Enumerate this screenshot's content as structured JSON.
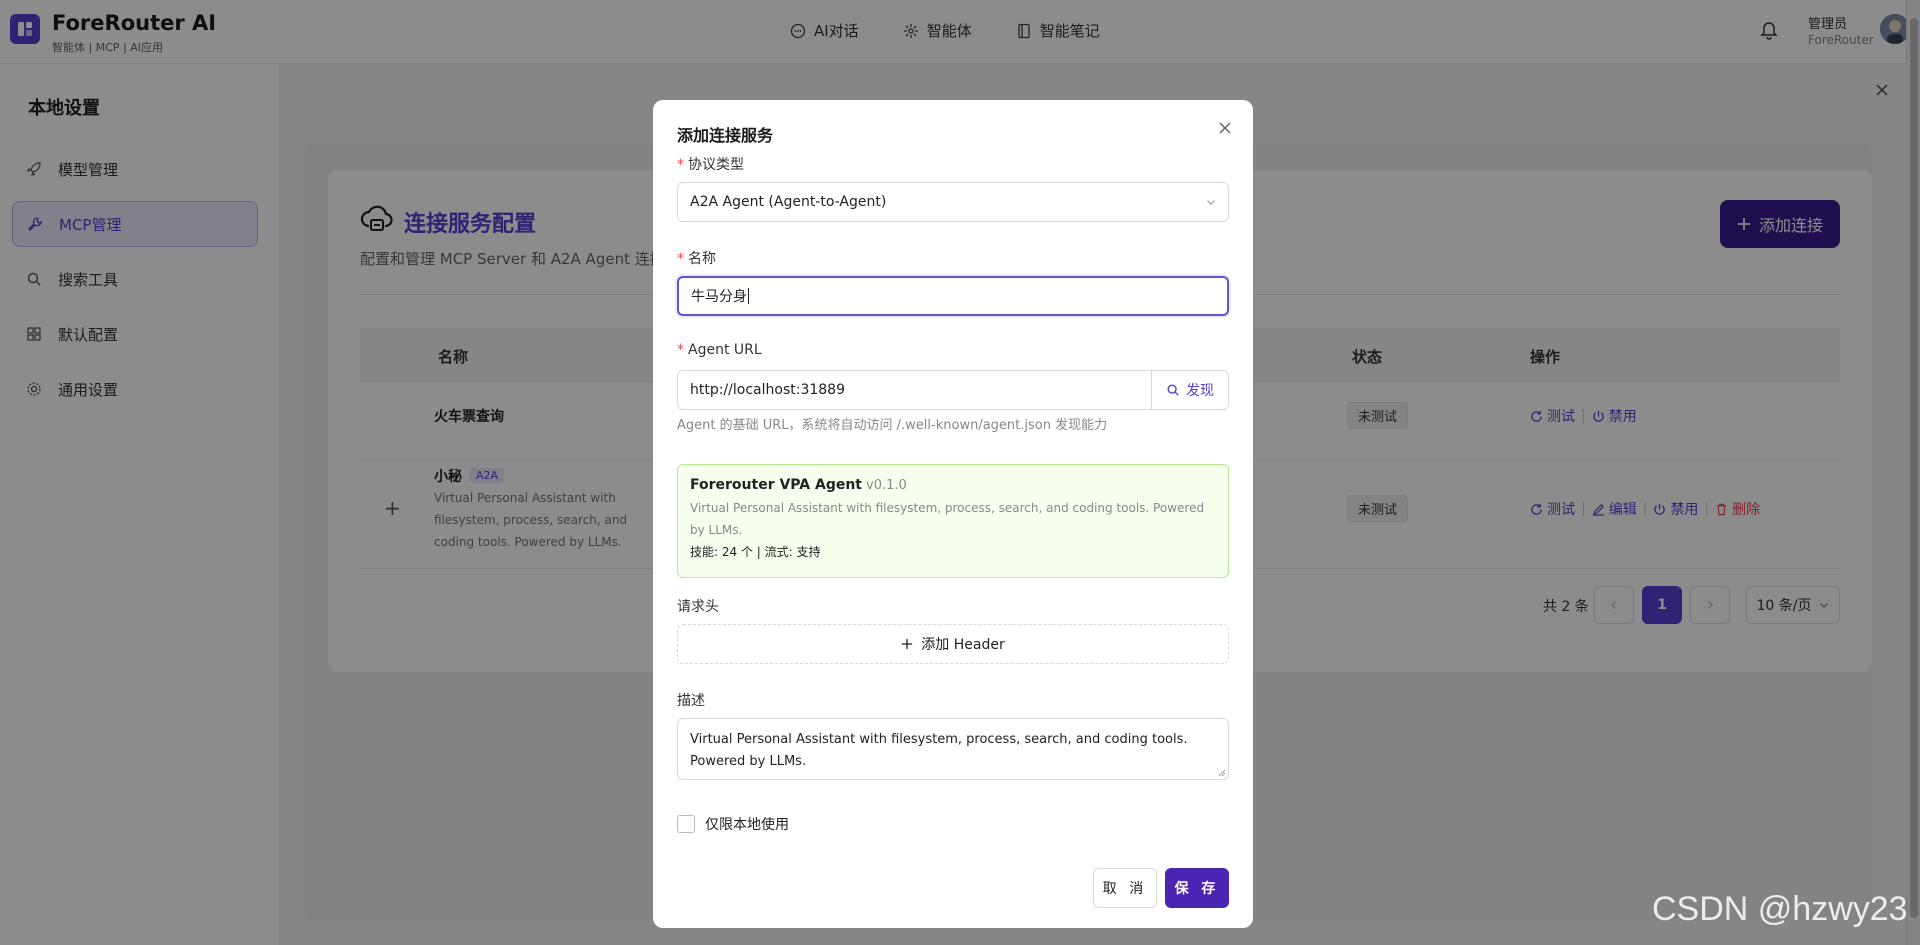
{
  "app": {
    "title": "ForeRouter AI",
    "subtitle": "智能体 | MCP | AI应用"
  },
  "nav": {
    "items": [
      {
        "label": "AI对话",
        "icon": "chat-icon"
      },
      {
        "label": "智能体",
        "icon": "agent-icon"
      },
      {
        "label": "智能笔记",
        "icon": "note-icon"
      }
    ]
  },
  "user": {
    "role": "管理员",
    "name": "ForeRouter"
  },
  "sidebar": {
    "title": "本地设置",
    "items": [
      {
        "label": "模型管理",
        "icon": "rocket-icon"
      },
      {
        "label": "MCP管理",
        "icon": "tool-icon",
        "active": true
      },
      {
        "label": "搜索工具",
        "icon": "search-icon"
      },
      {
        "label": "默认配置",
        "icon": "grid-icon"
      },
      {
        "label": "通用设置",
        "icon": "gear-icon"
      }
    ]
  },
  "page": {
    "title": "连接服务配置",
    "subtitle": "配置和管理 MCP Server 和 A2A Agent 连接，",
    "add_button": "添加连接"
  },
  "table": {
    "columns": {
      "name": "名称",
      "status": "状态",
      "ops": "操作"
    },
    "rows": [
      {
        "name": "火车票查询",
        "tag": "",
        "desc": "",
        "status": "未测试",
        "ops": {
          "test": "测试",
          "disable": "禁用"
        }
      },
      {
        "name": "小秘",
        "tag": "A2A",
        "desc": "Virtual Personal Assistant with filesystem, process, search, and coding tools. Powered by LLMs.",
        "status": "未测试",
        "ops": {
          "test": "测试",
          "edit": "编辑",
          "disable": "禁用",
          "delete": "删除"
        }
      }
    ]
  },
  "pager": {
    "total": "共 2 条",
    "current": "1",
    "page_size": "10 条/页"
  },
  "modal": {
    "title": "添加连接服务",
    "protocol_label": "协议类型",
    "protocol_value": "A2A Agent (Agent-to-Agent)",
    "name_label": "名称",
    "name_value": "牛马分身",
    "url_label": "Agent URL",
    "url_value": "http://localhost:31889",
    "discover_label": "发现",
    "url_help": "Agent 的基础 URL，系统将自动访问 /.well-known/agent.json 发现能力",
    "agent_info": {
      "name": "Forerouter VPA Agent",
      "version": "v0.1.0",
      "desc": "Virtual Personal Assistant with filesystem, process, search, and coding tools. Powered by LLMs.",
      "stats": "技能: 24 个 | 流式: 支持"
    },
    "headers_label": "请求头",
    "add_header_label": "添加 Header",
    "desc_label": "描述",
    "desc_value": "Virtual Personal Assistant with filesystem, process, search, and coding tools. Powered by LLMs.",
    "local_only_label": "仅限本地使用",
    "cancel_label": "取 消",
    "save_label": "保 存"
  },
  "watermark": "CSDN @hzwy23",
  "colors": {
    "accent": "#5b3fd1",
    "primary_button": "#4c24b3",
    "danger": "#e5484d",
    "success_bg": "#f6ffed"
  }
}
